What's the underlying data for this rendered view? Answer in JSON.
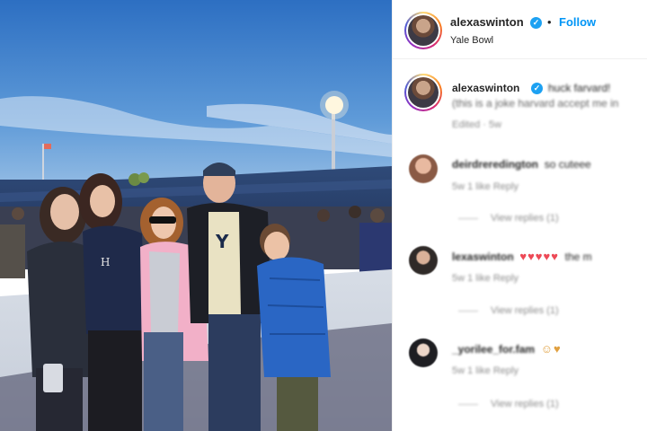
{
  "post": {
    "username": "alexaswinton",
    "follow_label": "Follow",
    "separator": "•",
    "location": "Yale Bowl",
    "verified_glyph": "✓"
  },
  "caption": {
    "username": "alexaswinton",
    "text": "huck farvard!",
    "line2": "(this is a joke harvard accept me in",
    "meta": "Edited · 5w"
  },
  "comments": [
    {
      "username": "deirdreredington",
      "text": "so cuteee",
      "meta": "5w   1 like   Reply",
      "view_replies": "View replies (1)"
    },
    {
      "username": "lexaswinton",
      "text": "the m",
      "emoji": "♥♥♥♥♥",
      "meta": "5w   1 like   Reply",
      "view_replies": "View replies (1)"
    },
    {
      "username": "_yorilee_for.fam",
      "text": "",
      "emoji": "☺♥",
      "meta": "5w   1 like   Reply",
      "view_replies": "View replies (1)"
    }
  ],
  "colors": {
    "accent": "#0095f6",
    "verified": "#1da1f2",
    "heart": "#ed4956",
    "muted": "#8e8e8e"
  },
  "icons": {
    "verified": "verified-badge-icon"
  }
}
